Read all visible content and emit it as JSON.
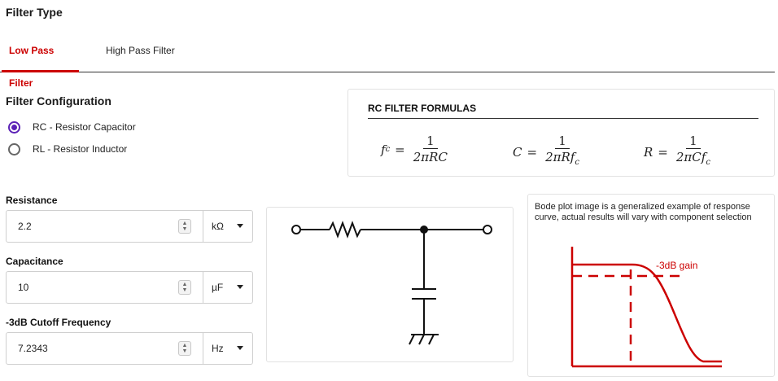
{
  "filter_type": {
    "title": "Filter Type",
    "tabs": [
      {
        "label": "Low Pass Filter",
        "active": true
      },
      {
        "label": "High Pass Filter",
        "active": false
      }
    ]
  },
  "configuration": {
    "title": "Filter Configuration",
    "options": [
      {
        "label": "RC - Resistor Capacitor",
        "selected": true
      },
      {
        "label": "RL - Resistor Inductor",
        "selected": false
      }
    ]
  },
  "formulas": {
    "title": "RC FILTER FORMULAS",
    "items": [
      {
        "lhs": "f",
        "lhs_sub": "c",
        "numerator": "1",
        "denominator": "2πRC"
      },
      {
        "lhs": "C",
        "lhs_sub": "",
        "numerator": "1",
        "denominator": "2πRf",
        "den_sub": "c"
      },
      {
        "lhs": "R",
        "lhs_sub": "",
        "numerator": "1",
        "denominator": "2πCf",
        "den_sub": "c"
      }
    ]
  },
  "fields": {
    "resistance": {
      "label": "Resistance",
      "value": "2.2",
      "unit": "kΩ"
    },
    "capacitance": {
      "label": "Capacitance",
      "value": "10",
      "unit": "µF"
    },
    "cutoff": {
      "label": "-3dB Cutoff Frequency",
      "value": "7.2343",
      "unit": "Hz"
    }
  },
  "bode": {
    "note": "Bode plot image is a generalized example of response curve, actual results will vary with component selection",
    "gain_label": "-3dB gain",
    "color": "#cc0000"
  },
  "colors": {
    "accent": "#cc0000",
    "radio": "#5b21b6"
  }
}
